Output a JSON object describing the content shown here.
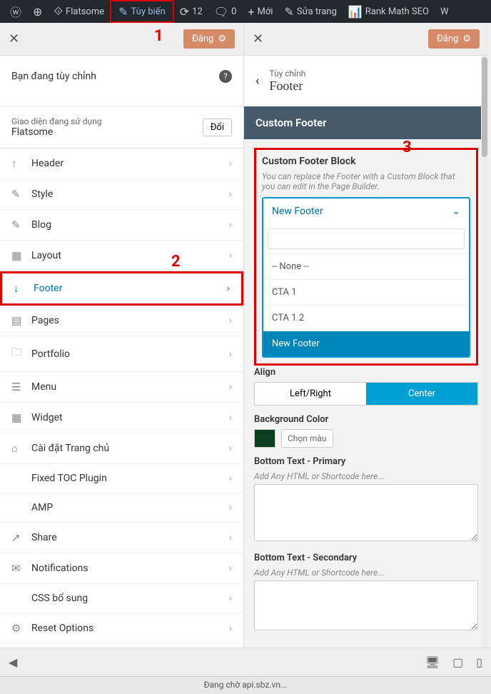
{
  "adminbar": {
    "flatsome": "Flatsome",
    "customize": "Tùy biến",
    "updates": "12",
    "comments": "0",
    "new": "Mới",
    "edit": "Sửa trang",
    "rankmath": "Rank Math SEO",
    "w": "W"
  },
  "annotations": {
    "a1": "1",
    "a2": "2",
    "a3": "3"
  },
  "left": {
    "publish": "Đăng",
    "customizing": "Bạn đang tùy chỉnh",
    "theme_label": "Giao diện đang sử dụng",
    "theme_name": "Flatsome",
    "change_btn": "Đổi",
    "menu": [
      {
        "label": "Header",
        "icon": "↑"
      },
      {
        "label": "Style",
        "icon": "✎"
      },
      {
        "label": "Blog",
        "icon": "✎"
      },
      {
        "label": "Layout",
        "icon": "▦"
      },
      {
        "label": "Footer",
        "icon": "↓"
      },
      {
        "label": "Pages",
        "icon": "▤"
      },
      {
        "label": "Portfolio",
        "icon": "🗀"
      },
      {
        "label": "Menu",
        "icon": "☰"
      },
      {
        "label": "Widget",
        "icon": "▦"
      },
      {
        "label": "Cài đặt Trang chủ",
        "icon": "⌂"
      },
      {
        "label": "Fixed TOC Plugin",
        "icon": ""
      },
      {
        "label": "AMP",
        "icon": ""
      },
      {
        "label": "Share",
        "icon": "↗"
      },
      {
        "label": "Notifications",
        "icon": "✉"
      },
      {
        "label": "CSS bổ sung",
        "icon": ""
      },
      {
        "label": "Reset Options",
        "icon": "⚙"
      }
    ]
  },
  "right": {
    "publish": "Đăng",
    "crumb": "Tùy chỉnh",
    "title": "Footer",
    "section": "Custom Footer",
    "block_title": "Custom Footer Block",
    "block_desc": "You can replace the Footer with a Custom Block that you can edit in the Page Builder.",
    "select_current": "New Footer",
    "options": [
      "-- None --",
      "CTA 1",
      "CTA 1.2",
      "New Footer"
    ],
    "align_label": "Align",
    "align_left": "Left/Right",
    "align_center": "Center",
    "bg_label": "Background Color",
    "bg_pick": "Chọn màu",
    "bg_color": "#0a3d1e",
    "bt1_label": "Bottom Text - Primary",
    "bt_desc": "Add Any HTML or Shortcode here...",
    "bt2_label": "Bottom Text - Secondary"
  },
  "status": "Đang chờ api.sbz.vn..."
}
